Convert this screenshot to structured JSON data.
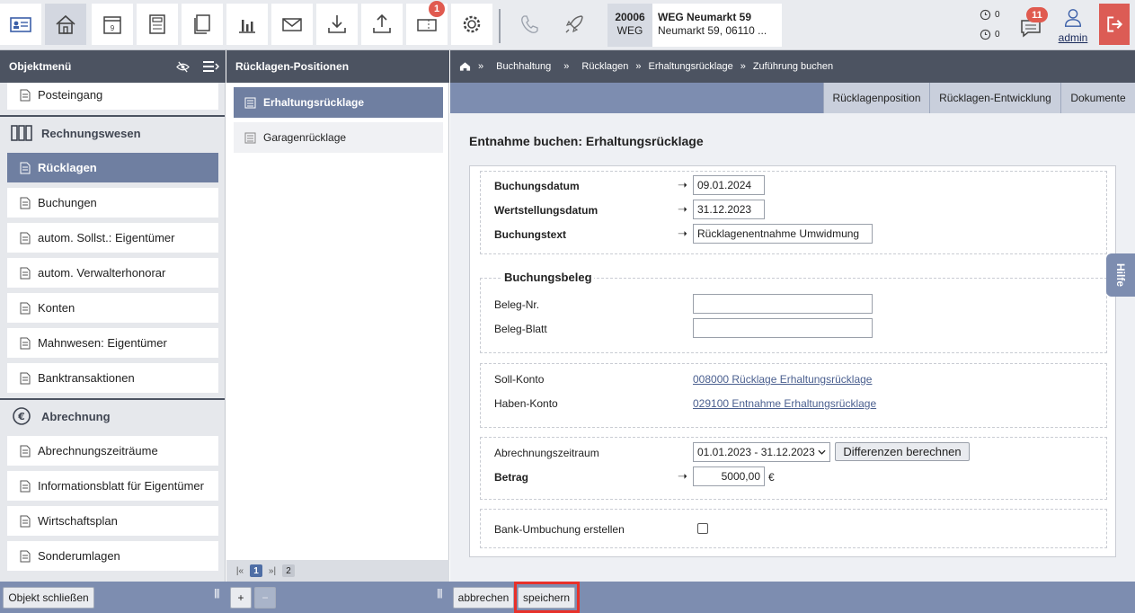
{
  "toolbar": {
    "notify_badge": "1",
    "object_id": "20006",
    "object_type": "WEG",
    "object_title": "WEG Neumarkt 59",
    "object_address": "Neumarkt 59, 06110 ...",
    "clock_count_1": "0",
    "clock_count_2": "0",
    "messages_badge": "11",
    "user": "admin"
  },
  "left_menu": {
    "header": "Objektmenü",
    "items_top": [
      "Posteingang"
    ],
    "group_1": "Rechnungswesen",
    "group_1_items": [
      "Rücklagen",
      "Buchungen",
      "autom. Sollst.: Eigentümer",
      "autom. Verwalterhonorar",
      "Konten",
      "Mahnwesen: Eigentümer",
      "Banktransaktionen"
    ],
    "group_2": "Abrechnung",
    "group_2_items": [
      "Abrechnungszeiträume",
      "Informationsblatt für Eigentümer",
      "Wirtschaftsplan",
      "Sonderumlagen"
    ]
  },
  "mid_list": {
    "header": "Rücklagen-Positionen",
    "items": [
      "Erhaltungsrücklage",
      "Garagenrücklage"
    ],
    "pager": {
      "first": "|«",
      "current": "1",
      "next": "»|",
      "page2": "2"
    }
  },
  "breadcrumb": [
    "Buchhaltung",
    "Rücklagen",
    "Erhaltungsrücklage",
    "Zuführung buchen"
  ],
  "tabs": [
    "Rücklagenposition",
    "Rücklagen-Entwicklung",
    "Dokumente"
  ],
  "form": {
    "title": "Entnahme buchen: Erhaltungsrücklage",
    "buchungsdatum_label": "Buchungsdatum",
    "buchungsdatum": "09.01.2024",
    "wertstellungsdatum_label": "Wertstellungsdatum",
    "wertstellungsdatum": "31.12.2023",
    "buchungstext_label": "Buchungstext",
    "buchungstext": "Rücklagenentnahme Umwidmung",
    "beleg_legend": "Buchungsbeleg",
    "beleg_nr_label": "Beleg-Nr.",
    "beleg_nr": "",
    "beleg_blatt_label": "Beleg-Blatt",
    "beleg_blatt": "",
    "soll_label": "Soll-Konto",
    "soll_value": "008000 Rücklage Erhaltungsrücklage",
    "haben_label": "Haben-Konto",
    "haben_value": "029100 Entnahme Erhaltungsrücklage",
    "zeitraum_label": "Abrechnungszeitraum",
    "zeitraum_value": "01.01.2023 - 31.12.2023",
    "differenzen_button": "Differenzen berechnen",
    "betrag_label": "Betrag",
    "betrag_value": "5000,00",
    "currency": "€",
    "bank_label": "Bank-Umbuchung erstellen"
  },
  "help_tab": "Hilfe",
  "bottom": {
    "close_object": "Objekt schließen",
    "add": "+",
    "remove": "−",
    "cancel": "abbrechen",
    "save": "speichern"
  },
  "colors": {
    "accent": "#6f7fa1",
    "dark_header": "#4c5361",
    "badge": "#e05a4f",
    "logout": "#dc5c55"
  }
}
